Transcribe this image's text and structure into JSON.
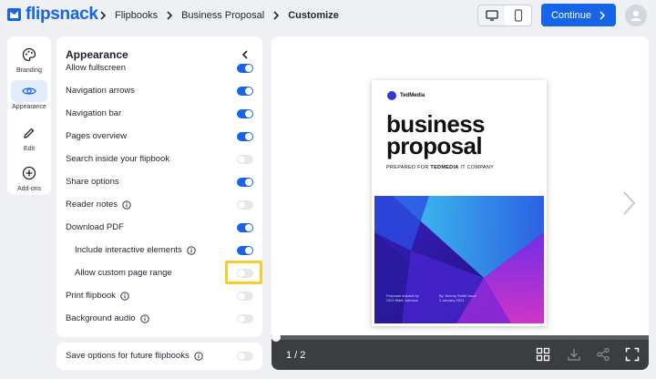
{
  "header": {
    "logo_text": "flipsnack",
    "breadcrumbs": [
      "Flipbooks",
      "Business Proposal",
      "Customize"
    ],
    "continue_label": "Continue",
    "brand_color": "#1565e6"
  },
  "rail": {
    "items": [
      {
        "label": "Branding",
        "icon": "palette-icon"
      },
      {
        "label": "Appearance",
        "icon": "eye-icon"
      },
      {
        "label": "Edit",
        "icon": "pencil-icon"
      },
      {
        "label": "Add-ons",
        "icon": "plus-circle-icon"
      }
    ]
  },
  "panel": {
    "title": "Appearance",
    "rows": [
      {
        "label": "Allow fullscreen",
        "on": true
      },
      {
        "label": "Navigation arrows",
        "on": true
      },
      {
        "label": "Navigation bar",
        "on": true
      },
      {
        "label": "Pages overview",
        "on": true
      },
      {
        "label": "Search inside your flipbook",
        "on": false
      },
      {
        "label": "Share options",
        "on": true
      },
      {
        "label": "Reader notes",
        "on": false,
        "info": true
      },
      {
        "label": "Download PDF",
        "on": true
      },
      {
        "label": "Include interactive elements",
        "on": true,
        "info": true,
        "indent": true
      },
      {
        "label": "Allow custom page range",
        "on": false,
        "indent": true
      },
      {
        "label": "Print flipbook",
        "on": false,
        "info": true
      },
      {
        "label": "Background audio",
        "on": false,
        "info": true
      }
    ],
    "save_options": {
      "label": "Save options for future flipbooks",
      "on": false,
      "info": true
    }
  },
  "preview": {
    "brand": "TedMedia",
    "doc_title_line1": "business",
    "doc_title_line2": "proposal",
    "doc_subtitle_prefix": "PREPARED FOR ",
    "doc_subtitle_bold": "TEDMEDIA",
    "doc_subtitle_suffix": " IT COMPANY",
    "art_left_line1": "Proposal request by",
    "art_left_line2": "CEO Mark Johnson",
    "art_right_line1": "By Jeremy Smith Issue",
    "art_right_line2": "3 January 2021",
    "page_counter": "1 / 2",
    "progress": 0
  },
  "colors": {
    "toggle_on": "#1565e6",
    "toggle_off": "#e6e8eb",
    "highlight": "#f6cd2a",
    "player_bg": "#3b3d40"
  }
}
